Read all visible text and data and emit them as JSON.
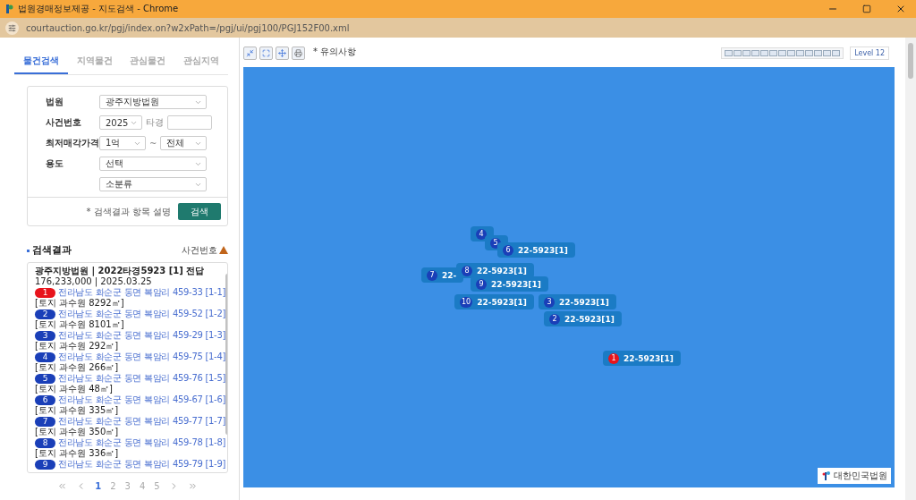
{
  "window": {
    "title": "법원경매정보제공 - 지도검색 - Chrome",
    "url": "courtauction.go.kr/pgj/index.on?w2xPath=/pgj/ui/pgj100/PGJ152F00.xml"
  },
  "tabs": [
    {
      "label": "물건검색",
      "selected": true
    },
    {
      "label": "지역물건",
      "selected": false
    },
    {
      "label": "관심물건",
      "selected": false
    },
    {
      "label": "관심지역",
      "selected": false
    }
  ],
  "form": {
    "rows": [
      {
        "label": "법원",
        "fields": [
          {
            "kind": "select",
            "value": "광주지방법원"
          }
        ]
      },
      {
        "label": "사건번호",
        "fields": [
          {
            "kind": "select",
            "value": "2025"
          },
          {
            "kind": "text",
            "label": "타경"
          }
        ]
      },
      {
        "label": "최저매각가격",
        "fields": [
          {
            "kind": "select",
            "value": "1억"
          },
          {
            "kind": "sep",
            "label": "~"
          },
          {
            "kind": "select",
            "value": "전체"
          }
        ]
      },
      {
        "label": "용도",
        "fields": [
          {
            "kind": "select",
            "value": "선택"
          }
        ]
      },
      {
        "label": "",
        "fields": [
          {
            "kind": "select",
            "value": "소분류"
          }
        ]
      }
    ],
    "help": "* 검색결과 항목 설명",
    "search_button": "검색"
  },
  "results": {
    "title": "검색결과",
    "sort": "사건번호",
    "header": "광주지방법원 | 2022타경5923 [1] 전답",
    "price_date": "176,233,000 | 2025.03.25",
    "items": [
      {
        "number": "1",
        "color": "#e8141c",
        "address": "전라남도 화순군 동면 복암리 459-33 [1-1]",
        "detail": "[토지 과수원 8292㎡]"
      },
      {
        "number": "2",
        "color": "#1a3fb8",
        "address": "전라남도 화순군 동면 복암리 459-52 [1-2]",
        "detail": "[토지 과수원 8101㎡]"
      },
      {
        "number": "3",
        "color": "#1a3fb8",
        "address": "전라남도 화순군 동면 복암리 459-29 [1-3]",
        "detail": "[토지 과수원 292㎡]"
      },
      {
        "number": "4",
        "color": "#1a3fb8",
        "address": "전라남도 화순군 동면 복암리 459-75 [1-4]",
        "detail": "[토지 과수원 266㎡]"
      },
      {
        "number": "5",
        "color": "#1a3fb8",
        "address": "전라남도 화순군 동면 복암리 459-76 [1-5]",
        "detail": "[토지 과수원 48㎡]"
      },
      {
        "number": "6",
        "color": "#1a3fb8",
        "address": "전라남도 화순군 동면 복암리 459-67 [1-6]",
        "detail": "[토지 과수원 335㎡]"
      },
      {
        "number": "7",
        "color": "#1a3fb8",
        "address": "전라남도 화순군 동면 복암리 459-77 [1-7]",
        "detail": "[토지 과수원 350㎡]"
      },
      {
        "number": "8",
        "color": "#1a3fb8",
        "address": "전라남도 화순군 동면 복암리 459-78 [1-8]",
        "detail": "[토지 과수원 336㎡]"
      },
      {
        "number": "9",
        "color": "#1a3fb8",
        "address": "전라남도 화순군 동면 복암리 459-79 [1-9]"
      }
    ]
  },
  "pagination": [
    {
      "label": "1",
      "selected": true
    },
    {
      "label": "2",
      "selected": false
    },
    {
      "label": "3",
      "selected": false
    },
    {
      "label": "4",
      "selected": false
    },
    {
      "label": "5",
      "selected": false
    }
  ],
  "map": {
    "note": "* 유의사항",
    "level": "Level 12",
    "logo_text": "대한민국법원",
    "markers": [
      {
        "number": "4",
        "color": "#1a3fb8"
      },
      {
        "number": "5",
        "color": "#1a3fb8"
      },
      {
        "number": "6",
        "color": "#1a3fb8",
        "label": "22-5923[1]"
      },
      {
        "number": "7",
        "color": "#1a3fb8",
        "label": "22-"
      },
      {
        "number": "8",
        "color": "#1a3fb8",
        "label": "22-5923[1]"
      },
      {
        "number": "9",
        "color": "#1a3fb8",
        "label": "22-5923[1]"
      },
      {
        "number": "10",
        "color": "#1a3fb8",
        "label": "22-5923[1]"
      },
      {
        "number": "3",
        "color": "#1a3fb8",
        "label": "22-5923[1]"
      },
      {
        "number": "2",
        "color": "#1a3fb8",
        "label": "22-5923[1]"
      },
      {
        "number": "1",
        "color": "#e8141c",
        "label": "22-5923[1]"
      }
    ]
  }
}
